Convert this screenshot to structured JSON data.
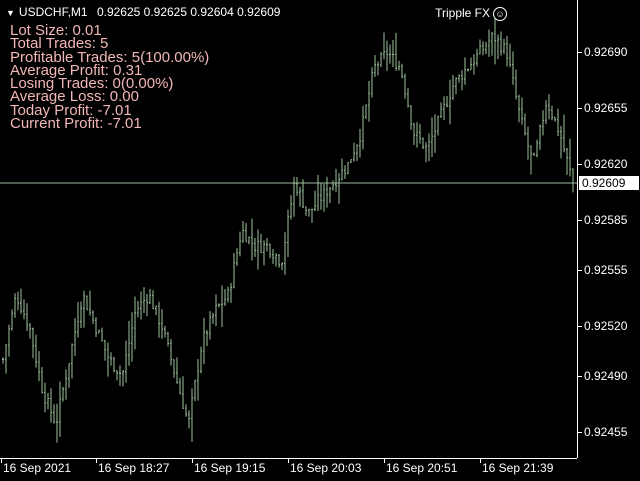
{
  "header": {
    "symbol": "USDCHF,M1",
    "ohlc": "0.92625 0.92625 0.92604 0.92609",
    "brand": "Tripple FX",
    "brand_icon": "smiley-icon"
  },
  "stats": [
    "Lot Size: 0.01",
    "Total Trades: 5",
    "Profitable Trades: 5(100.00%)",
    "Average Profit: 0.31",
    "Losing  Trades: 0(0.00%)",
    "Average Loss: 0.00",
    "Today Profit: -7.01",
    "Current Profit: -7.01"
  ],
  "colors": {
    "background": "#000000",
    "bars": "#9cc59a",
    "stats_text": "#f2b6b6",
    "axis": "#ffffff"
  },
  "current_price": "0.92609",
  "chart_data": {
    "type": "bar",
    "title": "USDCHF,M1",
    "ylim": [
      0.9243,
      0.9272
    ],
    "price_ticks": [
      "0.92690",
      "0.92655",
      "0.92620",
      "0.92585",
      "0.92555",
      "0.92520",
      "0.92490",
      "0.92455"
    ],
    "time_ticks": [
      "16 Sep 2021",
      "16 Sep 18:27",
      "16 Sep 19:15",
      "16 Sep 20:03",
      "16 Sep 20:51",
      "16 Sep 21:39"
    ],
    "close_path": [
      0.925,
      0.9254,
      0.9252,
      0.9248,
      0.9246,
      0.925,
      0.9254,
      0.9252,
      0.925,
      0.9249,
      0.9253,
      0.9254,
      0.9252,
      0.9249,
      0.9246,
      0.9251,
      0.9253,
      0.9254,
      0.9258,
      0.9257,
      0.9257,
      0.9256,
      0.9261,
      0.9259,
      0.926,
      0.9261,
      0.9262,
      0.9264,
      0.9268,
      0.9269,
      0.9268,
      0.9264,
      0.9263,
      0.9265,
      0.9267,
      0.9268,
      0.9269,
      0.927,
      0.9269,
      0.9265,
      0.9262,
      0.9266,
      0.9264,
      0.92609
    ]
  }
}
